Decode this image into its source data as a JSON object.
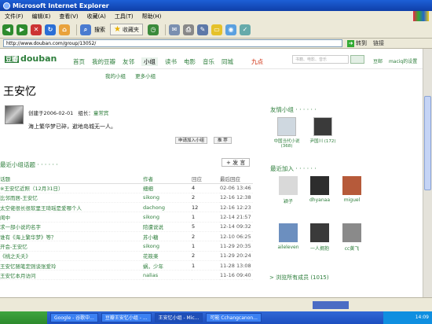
{
  "window": {
    "title": "Microsoft Internet Explorer"
  },
  "menu": [
    "文件(F)",
    "编辑(E)",
    "查看(V)",
    "收藏(A)",
    "工具(T)",
    "帮助(H)"
  ],
  "toolbar": {
    "search_label": "搜索",
    "favorites_label": "收藏夹"
  },
  "address": {
    "url": "http://www.douban.com/group/13052/",
    "go_label": "转到",
    "links_label": "链接"
  },
  "site": {
    "logo_cn": "豆瓣",
    "logo_en": "douban",
    "nav": [
      "首页",
      "我的豆瓣",
      "友邻",
      "小组",
      "读书",
      "电影",
      "音乐",
      "同城",
      "九点"
    ],
    "search_placeholder": "书籍、电影、音乐",
    "top_links": [
      "豆邮",
      "maciq的设置"
    ],
    "sub_nav": [
      "我的小组",
      "更多小组"
    ]
  },
  "group": {
    "name": "王安忆",
    "created": "创建于2006-02-01",
    "leader_label": "组长：",
    "leader": "童常宾",
    "quote": "海上繁华梦已碎，避地岛城无一人。",
    "join_label": "申请加入小组",
    "recommend_label": "推 荐"
  },
  "topics": {
    "title": "最近小组话题 · · · · · ·",
    "post_label": "+ 发 言",
    "headers": [
      "话题",
      "作者",
      "回应",
      "最后回应"
    ],
    "rows": [
      [
        "※王安忆近照（12月31日）",
        "细细",
        "4",
        "02-06 13:46"
      ],
      [
        "比邻而居-王安忆",
        "sikong",
        "2",
        "12-16 12:38"
      ],
      [
        "太空佬很长很软里王琦瑶是爱哪个人",
        "dachong",
        "12",
        "12-16 12:23"
      ],
      [
        "闺中",
        "sikong",
        "1",
        "12-14 21:57"
      ],
      [
        "求一部小说的名字",
        "陪遭说说",
        "5",
        "12-14 09:32"
      ],
      [
        "谁有《海上繁华梦》等？",
        "苏小糖",
        "2",
        "12-10 06:25"
      ],
      [
        "开会-王安忆",
        "sikong",
        "1",
        "11-29 20:35"
      ],
      [
        "《桃之夭夭》",
        "花筱楽",
        "2",
        "11-29 20:24"
      ],
      [
        "王安忆随笔定则谈张爱玲",
        "蜗，少年",
        "1",
        "11-28 13:08"
      ],
      [
        "王安忆本月访问",
        "nalias",
        "",
        "11-16 09:40"
      ]
    ]
  },
  "friend_groups": {
    "title": "友情小组 · · · · · ·",
    "items": [
      {
        "name": "中国当代小说 (368)",
        "color": "#cfd8e0"
      },
      {
        "name": "尹国川 (172)",
        "color": "#3a3a3a"
      }
    ]
  },
  "recent_members": {
    "title": "最近加入 · · · · · ·",
    "items": [
      {
        "name": "颖子",
        "color": "#d9d9d9"
      },
      {
        "name": "dhyanaa",
        "color": "#2d2d2d"
      },
      {
        "name": "miguel",
        "color": "#b65a3a"
      },
      {
        "name": "aileleven",
        "color": "#6c8fbf"
      },
      {
        "name": "一人拥抱",
        "color": "#3a3a3a"
      },
      {
        "name": "cc黄飞",
        "color": "#8a8a8a"
      }
    ],
    "all_link": "> 浏览所有成员 (1015)"
  },
  "taskbar": {
    "tasks": [
      "Google - 谷歌中...",
      "豆瓣王安忆小组 - ...",
      "王安忆小组 - Mic...",
      "可能 Cchangcanon..."
    ],
    "clock": "14:09"
  }
}
